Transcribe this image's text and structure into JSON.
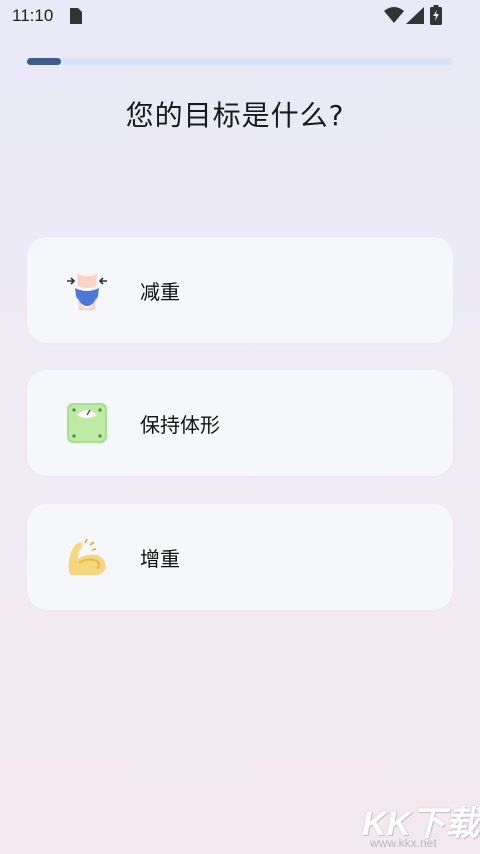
{
  "status_bar": {
    "time": "11:10"
  },
  "progress": {
    "value": 0.08
  },
  "question": {
    "title": "您的目标是什么?"
  },
  "options": [
    {
      "label": "减重",
      "icon": "waist-icon"
    },
    {
      "label": "保持体形",
      "icon": "scale-icon"
    },
    {
      "label": "增重",
      "icon": "bicep-icon"
    }
  ],
  "watermark": {
    "main": "KK下载",
    "url": "www.kkx.net"
  },
  "colors": {
    "progress_fill": "#3e5b8a",
    "progress_track": "#dae3f4",
    "card_bg": "#f6f7fb"
  }
}
